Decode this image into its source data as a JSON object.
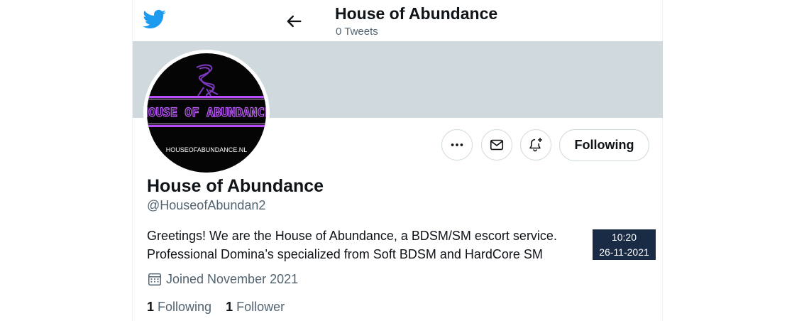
{
  "header": {
    "title": "House of Abundance",
    "tweet_count": "0 Tweets"
  },
  "avatar": {
    "logo_text": "HOUSE OF ABUNDANCE",
    "url_text": "HOUSEOFABUNDANCE.NL"
  },
  "actions": {
    "follow_label": "Following"
  },
  "profile": {
    "name": "House of Abundance",
    "handle": "@HouseofAbundan2",
    "bio_line1": "Greetings! We are the House of Abundance, a BDSM/SM escort service.",
    "bio_line2": "Professional Domina’s specialized from Soft BDSM and HardCore SM",
    "joined": "Joined November 2021"
  },
  "stats": {
    "following_count": "1",
    "following_label": "Following",
    "followers_count": "1",
    "followers_label": "Follower"
  },
  "clock": {
    "time": "10:20",
    "date": "26-11-2021"
  },
  "colors": {
    "twitter_blue": "#1d9bf0",
    "banner": "#cfd9de",
    "neon_purple": "#b84cff",
    "clock_bg": "#1a2b45"
  },
  "icons": [
    "twitter-bird-icon",
    "back-arrow-icon",
    "more-icon",
    "mail-icon",
    "notification-bell-icon",
    "calendar-icon"
  ]
}
